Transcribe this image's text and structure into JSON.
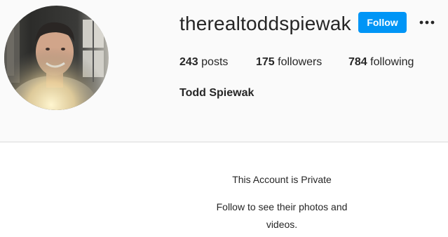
{
  "profile": {
    "username": "therealtoddspiewak",
    "full_name": "Todd Spiewak",
    "follow_label": "Follow",
    "stats": {
      "posts": {
        "count": "243",
        "label": "posts"
      },
      "followers": {
        "count": "175",
        "label": "followers"
      },
      "following": {
        "count": "784",
        "label": "following"
      }
    }
  },
  "private_notice": {
    "title": "This Account is Private",
    "subtitle": "Follow to see their photos and videos."
  },
  "icons": {
    "more": "more-options-icon",
    "avatar": "profile-photo"
  },
  "colors": {
    "accent": "#0095f6",
    "header_bg": "#fafafa",
    "divider": "#dbdbdb",
    "text": "#262626"
  }
}
